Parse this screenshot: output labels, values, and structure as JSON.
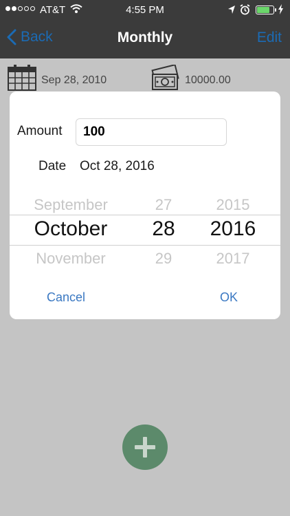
{
  "status_bar": {
    "carrier": "AT&T",
    "time": "4:55 PM"
  },
  "nav": {
    "back_label": "Back",
    "title": "Monthly",
    "edit_label": "Edit"
  },
  "info_row": {
    "start_date": "Sep 28, 2010",
    "amount": "10000.00"
  },
  "dialog": {
    "amount_label": "Amount",
    "amount_value": "100",
    "date_label": "Date",
    "date_value": "Oct 28, 2016",
    "picker": {
      "month": {
        "prev": "September",
        "selected": "October",
        "next": "November"
      },
      "day": {
        "prev": "27",
        "selected": "28",
        "next": "29"
      },
      "year": {
        "prev": "2015",
        "selected": "2016",
        "next": "2017"
      }
    },
    "cancel_label": "Cancel",
    "ok_label": "OK"
  },
  "colors": {
    "accent": "#3a78c2",
    "fab": "#5c8a6b",
    "overlay": "#c4c4c4"
  }
}
